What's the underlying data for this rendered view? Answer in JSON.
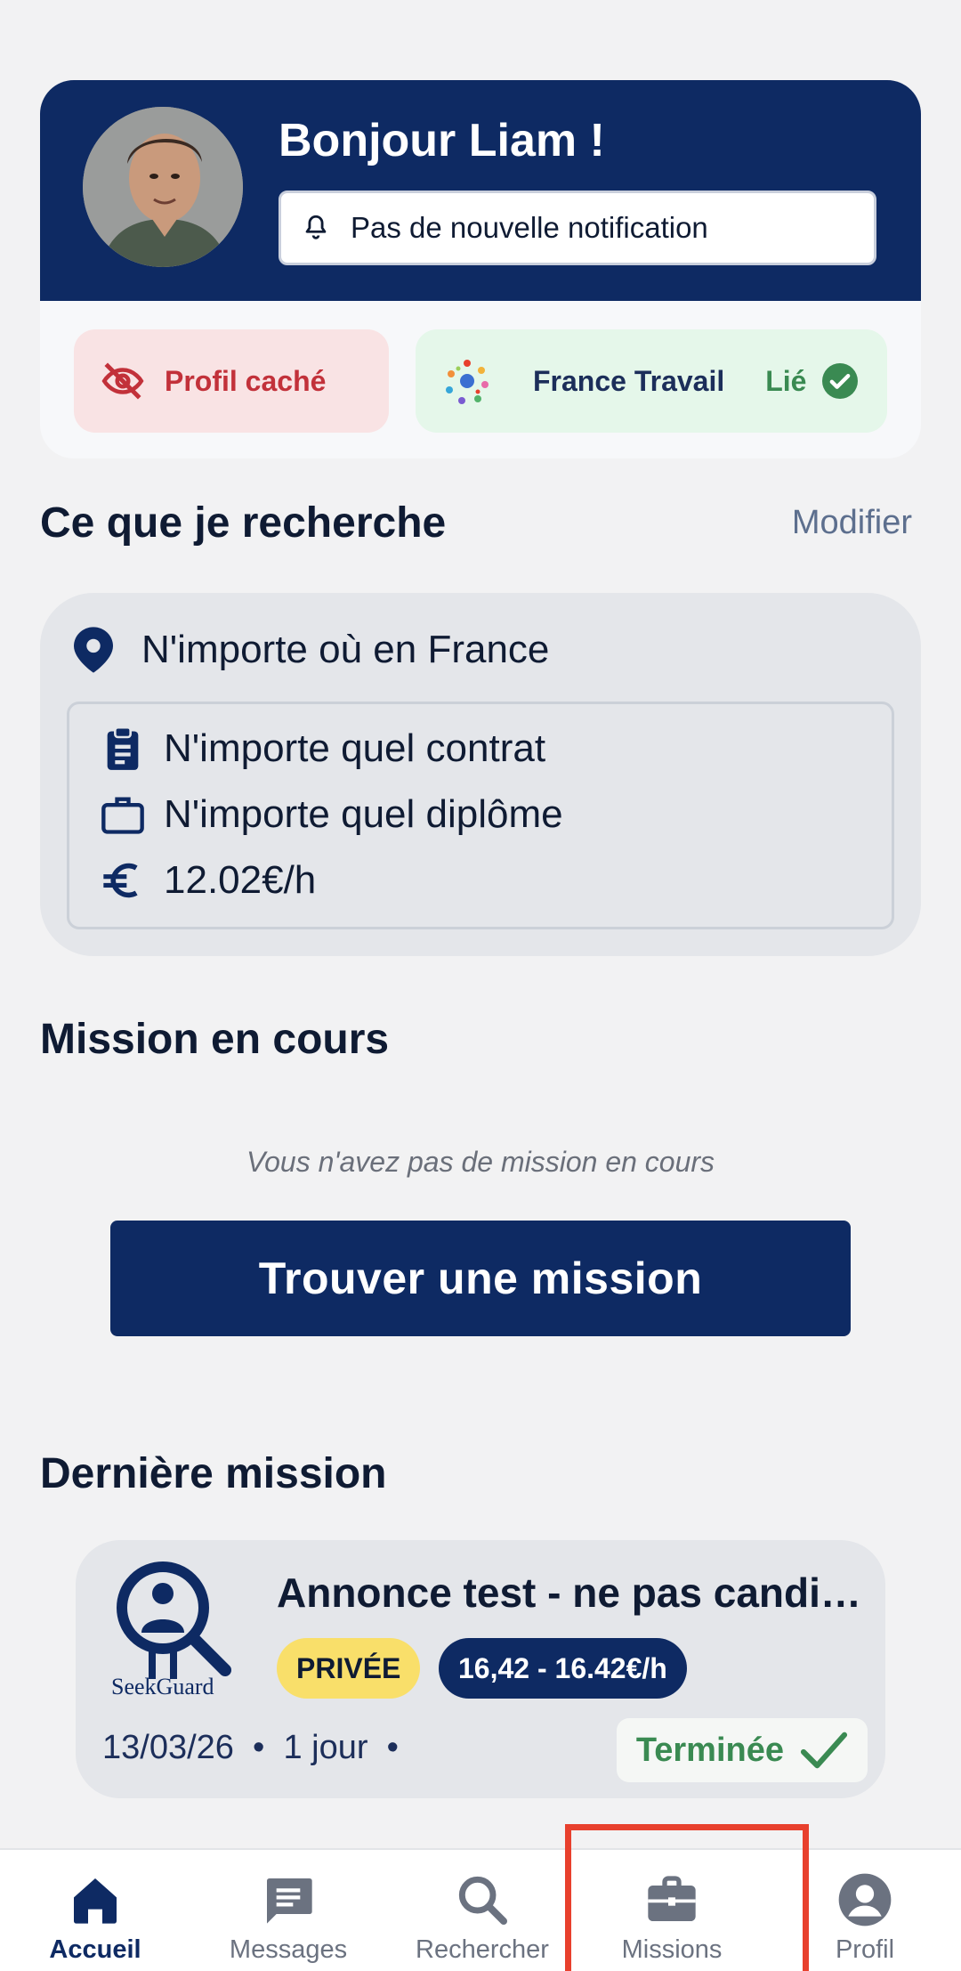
{
  "greeting": {
    "title": "Bonjour Liam !",
    "notification": "Pas de nouvelle notification"
  },
  "status_pills": {
    "profile_hidden": "Profil caché",
    "partner_name": "France Travail",
    "partner_status": "Lié"
  },
  "search": {
    "section_title": "Ce que je recherche",
    "modify_label": "Modifier",
    "location": "N'importe où en France",
    "contract": "N'importe quel contrat",
    "diploma": "N'importe quel diplôme",
    "rate": "12.02€/h"
  },
  "current_mission": {
    "section_title": "Mission en cours",
    "empty_text": "Vous n'avez pas de mission en cours",
    "find_button": "Trouver une mission"
  },
  "last_mission": {
    "section_title": "Dernière mission",
    "company": "SeekGuard",
    "title": "Annonce test - ne pas candid…",
    "tag_private": "PRIVÉE",
    "tag_rate": "16,42 - 16.42€/h",
    "date": "13/03/26",
    "duration": "1 jour",
    "status": "Terminée"
  },
  "nav": {
    "home": "Accueil",
    "messages": "Messages",
    "search": "Rechercher",
    "missions": "Missions",
    "profile": "Profil"
  },
  "colors": {
    "brand_navy": "#0e2a63",
    "success_green": "#3a8a52",
    "danger_red": "#c2313a",
    "highlight_red": "#e8402d",
    "private_yellow": "#f9df6a"
  }
}
